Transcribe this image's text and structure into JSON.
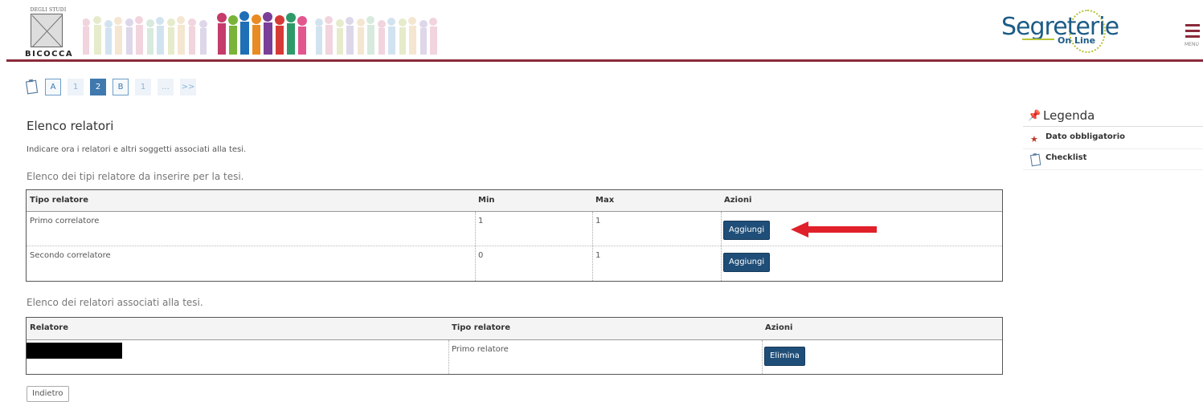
{
  "header": {
    "university_top": "DEGLI STUDI",
    "university_bottom": "BICOCCA",
    "brand_word": "Segreterie",
    "brand_sub": "On Line",
    "menu_label": "MENU",
    "accent_color": "#8a2a3a"
  },
  "steps": [
    {
      "label": "A",
      "style": "box"
    },
    {
      "label": "1",
      "style": "dim"
    },
    {
      "label": "2",
      "style": "active"
    },
    {
      "label": "B",
      "style": "box"
    },
    {
      "label": "1",
      "style": "dim"
    },
    {
      "label": "...",
      "style": "dim"
    },
    {
      "label": ">>",
      "style": "dim"
    }
  ],
  "page": {
    "title": "Elenco relatori",
    "intro": "Indicare ora i relatori e altri soggetti associati alla tesi."
  },
  "types_table": {
    "caption": "Elenco dei tipi relatore da inserire per la tesi.",
    "headers": [
      "Tipo relatore",
      "Min",
      "Max",
      "Azioni"
    ],
    "rows": [
      {
        "tipo": "Primo correlatore",
        "min": "1",
        "max": "1",
        "action": "Aggiungi"
      },
      {
        "tipo": "Secondo correlatore",
        "min": "0",
        "max": "1",
        "action": "Aggiungi"
      }
    ]
  },
  "assoc_table": {
    "caption": "Elenco dei relatori associati alla tesi.",
    "headers": [
      "Relatore",
      "Tipo relatore",
      "Azioni"
    ],
    "rows": [
      {
        "relatore": "",
        "tipo": "Primo relatore",
        "action": "Elimina"
      }
    ]
  },
  "back_button": "Indietro",
  "legend": {
    "title": "Legenda",
    "items": [
      {
        "label": "Dato obbligatorio",
        "icon": "star-icon",
        "color": "#c0392b"
      },
      {
        "label": "Checklist",
        "icon": "clipboard-icon",
        "color": "#3b79b0"
      }
    ]
  },
  "annotation_arrow_color": "#e0202a",
  "button_color": "#1f4e78"
}
